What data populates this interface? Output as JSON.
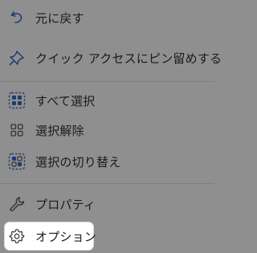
{
  "menu": {
    "items": [
      {
        "label": "元に戻す",
        "icon": "undo-icon"
      },
      {
        "label": "クイック アクセスにピン留めする",
        "icon": "pin-icon"
      },
      {
        "label": "すべて選択",
        "icon": "select-all-icon"
      },
      {
        "label": "選択解除",
        "icon": "select-none-icon"
      },
      {
        "label": "選択の切り替え",
        "icon": "invert-selection-icon"
      },
      {
        "label": "プロパティ",
        "icon": "wrench-icon"
      },
      {
        "label": "オプション",
        "icon": "gear-icon"
      }
    ]
  },
  "colors": {
    "backdrop": "#8f8f8f",
    "accent": "#1f3b6e",
    "highlight": "#ffffff",
    "text": "#1b1b1b"
  }
}
